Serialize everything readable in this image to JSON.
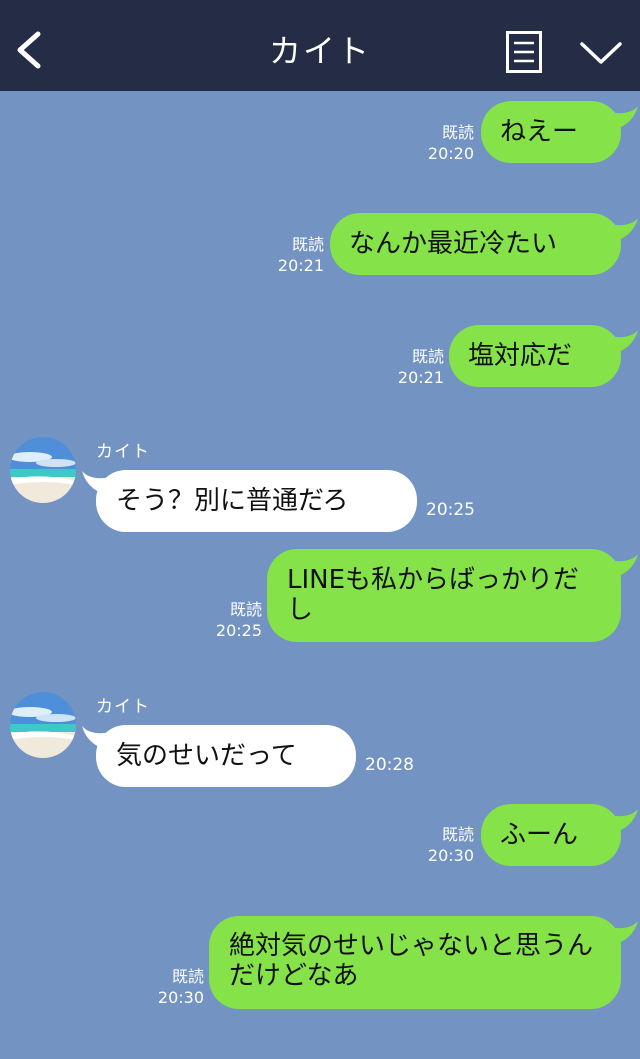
{
  "header": {
    "title": "カイト",
    "back_icon": "chevron-left-icon",
    "menu_icon": "list-icon",
    "collapse_icon": "chevron-down-icon"
  },
  "colors": {
    "background": "#7393c3",
    "header": "#242d45",
    "outgoing_bubble": "#85e249",
    "incoming_bubble": "#ffffff"
  },
  "messages": [
    {
      "direction": "out",
      "text": "ねえー",
      "read": "既読",
      "time": "20:20"
    },
    {
      "direction": "out",
      "text": "なんか最近冷たい",
      "read": "既読",
      "time": "20:21"
    },
    {
      "direction": "out",
      "text": "塩対応だ",
      "read": "既読",
      "time": "20:21"
    },
    {
      "direction": "in",
      "sender": "カイト",
      "text": "そう？別に普通だろ",
      "time": "20:25"
    },
    {
      "direction": "out",
      "text": "LINEも私からばっかりだし",
      "read": "既読",
      "time": "20:25"
    },
    {
      "direction": "in",
      "sender": "カイト",
      "text": "気のせいだって",
      "time": "20:28"
    },
    {
      "direction": "out",
      "text": "ふーん",
      "read": "既読",
      "time": "20:30"
    },
    {
      "direction": "out",
      "text": "絶対気のせいじゃないと思うんだけどなあ",
      "read": "既読",
      "time": "20:30"
    }
  ]
}
